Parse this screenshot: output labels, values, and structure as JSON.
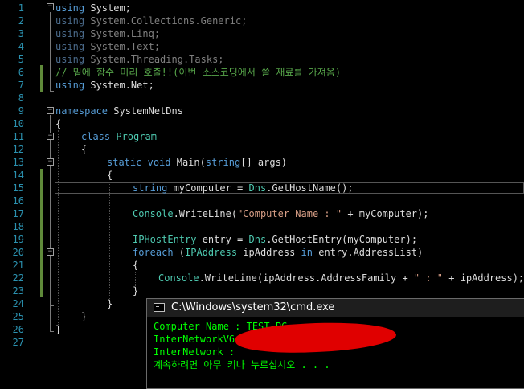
{
  "editor": {
    "lines": [
      {
        "n": "1",
        "parts": [
          {
            "t": "using",
            "c": "kw"
          },
          {
            "t": " System;",
            "c": ""
          }
        ]
      },
      {
        "n": "2",
        "parts": [
          {
            "t": "using",
            "c": "dimkw"
          },
          {
            "t": " System.Collections.Generic;",
            "c": "dim"
          }
        ]
      },
      {
        "n": "3",
        "parts": [
          {
            "t": "using",
            "c": "dimkw"
          },
          {
            "t": " System.Linq;",
            "c": "dim"
          }
        ]
      },
      {
        "n": "4",
        "parts": [
          {
            "t": "using",
            "c": "dimkw"
          },
          {
            "t": " System.Text;",
            "c": "dim"
          }
        ]
      },
      {
        "n": "5",
        "parts": [
          {
            "t": "using",
            "c": "dimkw"
          },
          {
            "t": " System.Threading.Tasks;",
            "c": "dim"
          }
        ]
      },
      {
        "n": "6",
        "parts": [
          {
            "t": "// 밑에 함수 미리 호출!!(이번 소스코딩에서 쓸 재료를 가져옴)",
            "c": "cm"
          }
        ]
      },
      {
        "n": "7",
        "parts": [
          {
            "t": "using",
            "c": "kw"
          },
          {
            "t": " System.Net;",
            "c": ""
          }
        ]
      },
      {
        "n": "8",
        "parts": []
      },
      {
        "n": "9",
        "parts": [
          {
            "t": "namespace",
            "c": "kw"
          },
          {
            "t": " SystemNetDns",
            "c": ""
          }
        ]
      },
      {
        "n": "10",
        "parts": [
          {
            "t": "{",
            "c": ""
          }
        ]
      },
      {
        "n": "11",
        "parts": [
          {
            "t": "class",
            "c": "kw"
          },
          {
            "t": " ",
            "c": ""
          },
          {
            "t": "Program",
            "c": "ty"
          }
        ]
      },
      {
        "n": "12",
        "parts": [
          {
            "t": "{",
            "c": ""
          }
        ]
      },
      {
        "n": "13",
        "parts": [
          {
            "t": "static",
            "c": "kw"
          },
          {
            "t": " ",
            "c": ""
          },
          {
            "t": "void",
            "c": "kw"
          },
          {
            "t": " Main(",
            "c": ""
          },
          {
            "t": "string",
            "c": "kw"
          },
          {
            "t": "[] args)",
            "c": ""
          }
        ]
      },
      {
        "n": "14",
        "parts": [
          {
            "t": "{",
            "c": ""
          }
        ]
      },
      {
        "n": "15",
        "parts": [
          {
            "t": "string",
            "c": "kw"
          },
          {
            "t": " myComputer = ",
            "c": ""
          },
          {
            "t": "Dns",
            "c": "ty"
          },
          {
            "t": ".GetHostName();",
            "c": ""
          }
        ]
      },
      {
        "n": "16",
        "parts": []
      },
      {
        "n": "17",
        "parts": [
          {
            "t": "Console",
            "c": "ty"
          },
          {
            "t": ".WriteLine(",
            "c": ""
          },
          {
            "t": "\"Computer Name : \"",
            "c": "str"
          },
          {
            "t": " + myComputer);",
            "c": ""
          }
        ]
      },
      {
        "n": "18",
        "parts": []
      },
      {
        "n": "19",
        "parts": [
          {
            "t": "IPHostEntry",
            "c": "ty"
          },
          {
            "t": " entry = ",
            "c": ""
          },
          {
            "t": "Dns",
            "c": "ty"
          },
          {
            "t": ".GetHostEntry(myComputer);",
            "c": ""
          }
        ]
      },
      {
        "n": "20",
        "parts": [
          {
            "t": "foreach",
            "c": "kw"
          },
          {
            "t": " (",
            "c": ""
          },
          {
            "t": "IPAddress",
            "c": "ty"
          },
          {
            "t": " ipAddress ",
            "c": ""
          },
          {
            "t": "in",
            "c": "kw"
          },
          {
            "t": " entry.AddressList)",
            "c": ""
          }
        ]
      },
      {
        "n": "21",
        "parts": [
          {
            "t": "{",
            "c": ""
          }
        ]
      },
      {
        "n": "22",
        "parts": [
          {
            "t": "Console",
            "c": "ty"
          },
          {
            "t": ".WriteLine(ipAddress.AddressFamily + ",
            "c": ""
          },
          {
            "t": "\" : \"",
            "c": "str"
          },
          {
            "t": " + ipAddress);",
            "c": ""
          }
        ]
      },
      {
        "n": "23",
        "parts": [
          {
            "t": "}",
            "c": ""
          }
        ]
      },
      {
        "n": "24",
        "parts": [
          {
            "t": "}",
            "c": ""
          }
        ]
      },
      {
        "n": "25",
        "parts": [
          {
            "t": "}",
            "c": ""
          }
        ]
      },
      {
        "n": "26",
        "parts": [
          {
            "t": "}",
            "c": ""
          }
        ]
      },
      {
        "n": "27",
        "parts": []
      }
    ]
  },
  "cmd": {
    "title": "C:\\Windows\\system32\\cmd.exe",
    "output": [
      "Computer Name : TEST-PC",
      "InterNetworkV6 :",
      "InterNetwork :",
      "계속하려면 아무 키나 누르십시오 . . ."
    ]
  }
}
